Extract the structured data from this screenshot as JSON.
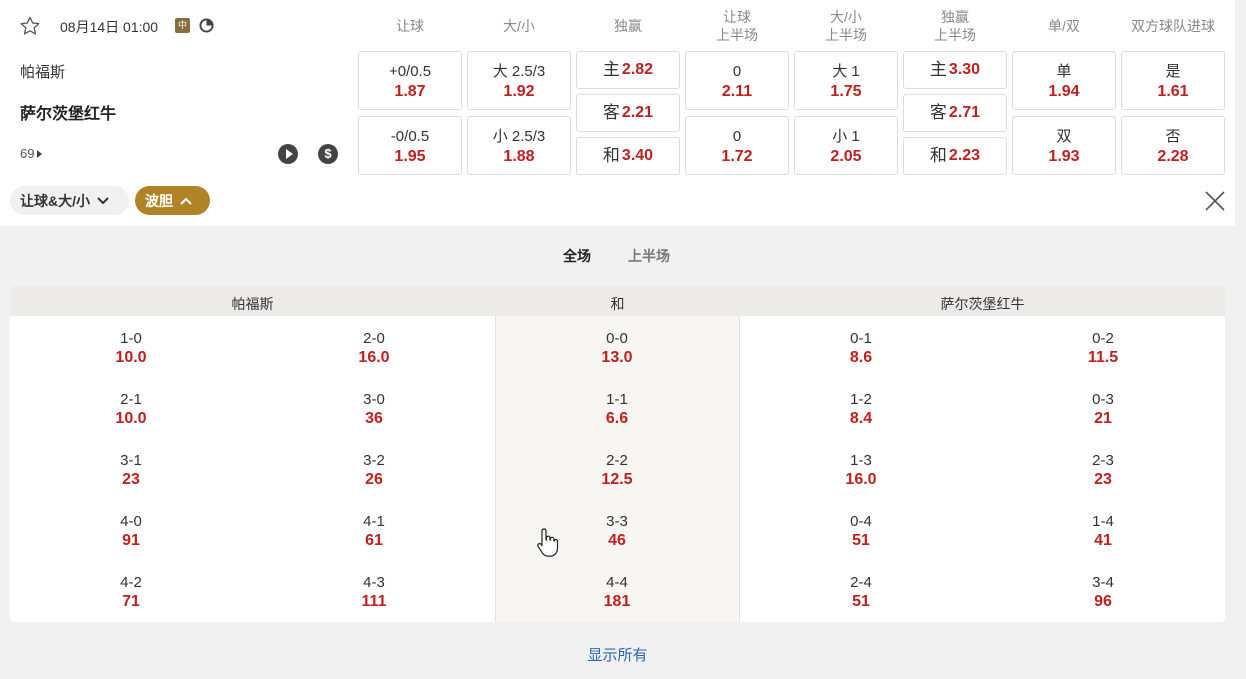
{
  "match": {
    "date": "08月14日 01:00",
    "lang_badge": "中",
    "home_team": "帕福斯",
    "away_team": "萨尔茨堡红牛",
    "minute": "69"
  },
  "columns": [
    {
      "line1": "让球",
      "line2": ""
    },
    {
      "line1": "大/小",
      "line2": ""
    },
    {
      "line1": "独赢",
      "line2": ""
    },
    {
      "line1": "让球",
      "line2": "上半场"
    },
    {
      "line1": "大/小",
      "line2": "上半场"
    },
    {
      "line1": "独赢",
      "line2": "上半场"
    },
    {
      "line1": "单/双",
      "line2": ""
    },
    {
      "line1": "双方球队进球",
      "line2": ""
    }
  ],
  "odds": {
    "handicap": [
      {
        "label": "+0/0.5",
        "odd": "1.87"
      },
      {
        "label": "-0/0.5",
        "odd": "1.95"
      }
    ],
    "overunder": [
      {
        "label": "大 2.5/3",
        "odd": "1.92"
      },
      {
        "label": "小 2.5/3",
        "odd": "1.88"
      }
    ],
    "moneyline": [
      {
        "label": "主",
        "odd": "2.82"
      },
      {
        "label": "客",
        "odd": "2.21"
      },
      {
        "label": "和",
        "odd": "3.40"
      }
    ],
    "handicap_ht": [
      {
        "label": "0",
        "odd": "2.11"
      },
      {
        "label": "0",
        "odd": "1.72"
      }
    ],
    "overunder_ht": [
      {
        "label": "大 1",
        "odd": "1.75"
      },
      {
        "label": "小 1",
        "odd": "2.05"
      }
    ],
    "moneyline_ht": [
      {
        "label": "主",
        "odd": "3.30"
      },
      {
        "label": "客",
        "odd": "2.71"
      },
      {
        "label": "和",
        "odd": "2.23"
      }
    ],
    "oddeven": [
      {
        "label": "单",
        "odd": "1.94"
      },
      {
        "label": "双",
        "odd": "1.93"
      }
    ],
    "btts": [
      {
        "label": "是",
        "odd": "1.61"
      },
      {
        "label": "否",
        "odd": "2.28"
      }
    ]
  },
  "filters": {
    "pill1": "让球&大/小",
    "pill2": "波胆"
  },
  "subtabs": {
    "full": "全场",
    "half": "上半场"
  },
  "correct_score": {
    "home_header": "帕福斯",
    "draw_header": "和",
    "away_header": "萨尔茨堡红牛",
    "home_a": [
      {
        "s": "1-0",
        "o": "10.0"
      },
      {
        "s": "2-1",
        "o": "10.0"
      },
      {
        "s": "3-1",
        "o": "23"
      },
      {
        "s": "4-0",
        "o": "91"
      },
      {
        "s": "4-2",
        "o": "71"
      }
    ],
    "home_b": [
      {
        "s": "2-0",
        "o": "16.0"
      },
      {
        "s": "3-0",
        "o": "36"
      },
      {
        "s": "3-2",
        "o": "26"
      },
      {
        "s": "4-1",
        "o": "61"
      },
      {
        "s": "4-3",
        "o": "111"
      }
    ],
    "draw": [
      {
        "s": "0-0",
        "o": "13.0"
      },
      {
        "s": "1-1",
        "o": "6.6"
      },
      {
        "s": "2-2",
        "o": "12.5"
      },
      {
        "s": "3-3",
        "o": "46"
      },
      {
        "s": "4-4",
        "o": "181"
      }
    ],
    "away_a": [
      {
        "s": "0-1",
        "o": "8.6"
      },
      {
        "s": "1-2",
        "o": "8.4"
      },
      {
        "s": "1-3",
        "o": "16.0"
      },
      {
        "s": "0-4",
        "o": "51"
      },
      {
        "s": "2-4",
        "o": "51"
      }
    ],
    "away_b": [
      {
        "s": "0-2",
        "o": "11.5"
      },
      {
        "s": "0-3",
        "o": "21"
      },
      {
        "s": "2-3",
        "o": "23"
      },
      {
        "s": "1-4",
        "o": "41"
      },
      {
        "s": "3-4",
        "o": "96"
      }
    ]
  },
  "show_all": "显示所有",
  "colors": {
    "odd": "#c0201e",
    "gold": "#b08326",
    "link": "#2a66b3"
  }
}
